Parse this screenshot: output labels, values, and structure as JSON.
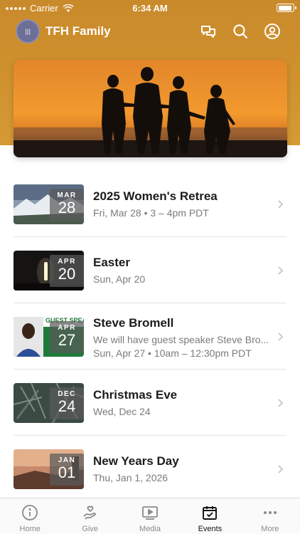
{
  "status_bar": {
    "carrier": "Carrier",
    "time": "6:34 AM"
  },
  "app": {
    "title": "TFH Family",
    "avatar_text": "|||"
  },
  "events": [
    {
      "month": "MAR",
      "day": "28",
      "title": "2025 Women's Retrea",
      "lines": [
        "Fri, Mar 28 • 3 – 4pm PDT"
      ]
    },
    {
      "month": "APR",
      "day": "20",
      "title": "Easter",
      "lines": [
        "Sun, Apr 20"
      ]
    },
    {
      "month": "APR",
      "day": "27",
      "title": "Steve Bromell",
      "lines": [
        "We will have guest speaker Steve Bro...",
        "Sun, Apr 27 • 10am – 12:30pm PDT"
      ],
      "thumb_text": "GUEST SPEAKER"
    },
    {
      "month": "DEC",
      "day": "24",
      "title": "Christmas Eve",
      "lines": [
        "Wed, Dec 24"
      ]
    },
    {
      "month": "JAN",
      "day": "01",
      "title": "New Years Day",
      "lines": [
        "Thu, Jan 1, 2026"
      ]
    }
  ],
  "tabs": [
    {
      "label": "Home",
      "icon": "info-circle-icon",
      "active": false
    },
    {
      "label": "Give",
      "icon": "hand-heart-icon",
      "active": false
    },
    {
      "label": "Media",
      "icon": "play-icon",
      "active": false
    },
    {
      "label": "Events",
      "icon": "calendar-check-icon",
      "active": true
    },
    {
      "label": "More",
      "icon": "ellipsis-icon",
      "active": false
    }
  ],
  "colors": {
    "header": "#d0912e",
    "active_tab": "#111111",
    "inactive_tab": "#8a8a8a"
  }
}
